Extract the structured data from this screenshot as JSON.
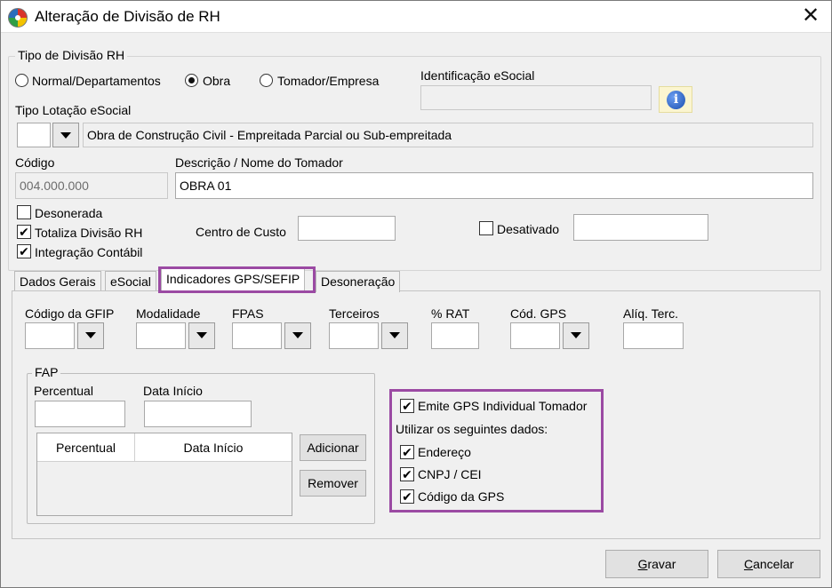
{
  "window": {
    "title": "Alteração de Divisão de RH",
    "close_glyph": "✕",
    "app_icon": "colorful-circle-icon"
  },
  "tipo_divisao": {
    "legend": "Tipo de Divisão RH",
    "options": [
      {
        "label": "Normal/Departamentos",
        "selected": false
      },
      {
        "label": "Obra",
        "selected": true
      },
      {
        "label": "Tomador/Empresa",
        "selected": false
      }
    ]
  },
  "identificacao_esocial": {
    "label": "Identificação eSocial",
    "value": "",
    "info_glyph": "i"
  },
  "tipo_lotacao": {
    "label": "Tipo Lotação eSocial",
    "code": "",
    "description": "Obra de Construção Civil - Empreitada Parcial ou Sub-empreitada"
  },
  "codigo": {
    "label": "Código",
    "value": "004.000.000"
  },
  "descricao": {
    "label": "Descrição / Nome do Tomador",
    "value": "OBRA 01"
  },
  "checkboxes": {
    "desonerada": {
      "label": "Desonerada",
      "checked": false
    },
    "totaliza": {
      "label": "Totaliza Divisão RH",
      "checked": true
    },
    "integracao": {
      "label": "Integração Contábil",
      "checked": true
    },
    "desativado": {
      "label": "Desativado",
      "checked": false
    }
  },
  "centro_custo": {
    "label": "Centro de Custo",
    "value": ""
  },
  "desativado_value": "",
  "tabs": [
    {
      "label": "Dados Gerais",
      "active": false
    },
    {
      "label": "eSocial",
      "active": false
    },
    {
      "label": "Indicadores GPS/SEFIP",
      "active": true
    },
    {
      "label": "Desoneração",
      "active": false
    }
  ],
  "gps_fields": {
    "codigo_gfip": "Código da GFIP",
    "modalidade": "Modalidade",
    "fpas": "FPAS",
    "terceiros": "Terceiros",
    "rat": "% RAT",
    "cod_gps": "Cód. GPS",
    "aliq_terc": "Alíq. Terc."
  },
  "fap": {
    "legend": "FAP",
    "percentual_label": "Percentual",
    "data_inicio_label": "Data Início",
    "grid_columns": [
      "Percentual",
      "Data Início"
    ],
    "add_button": "Adicionar",
    "remove_button": "Remover"
  },
  "gps_options": {
    "emite": {
      "label": "Emite GPS Individual Tomador",
      "checked": true
    },
    "utilizar_label": "Utilizar os seguintes dados:",
    "endereco": {
      "label": "Endereço",
      "checked": true
    },
    "cnpj": {
      "label": "CNPJ / CEI",
      "checked": true
    },
    "codigo_gps": {
      "label": "Código da GPS",
      "checked": true
    }
  },
  "footer": {
    "gravar": {
      "accel": "G",
      "rest": "ravar"
    },
    "cancelar": {
      "accel": "C",
      "rest": "ancelar"
    }
  },
  "colors": {
    "highlight": "#9b4aa3",
    "window_bg": "#f0f0f0",
    "info_bg": "#fbf5d0"
  },
  "check_glyph": "✔"
}
